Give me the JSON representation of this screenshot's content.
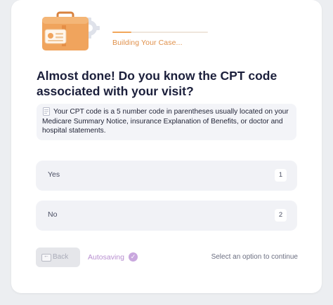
{
  "header": {
    "progress_fraction": 0.2,
    "status_text": "Building Your Case..."
  },
  "question": {
    "title": "Almost done! Do you know the CPT code associated with your visit?"
  },
  "hint": {
    "icon": "document-icon",
    "text": "Your CPT code is a 5 number code in parentheses usually located on your Medicare Summary Notice, insurance Explanation of Benefits, or doctor and hospital statements."
  },
  "options": [
    {
      "label": "Yes",
      "key": "1"
    },
    {
      "label": "No",
      "key": "2"
    }
  ],
  "footer": {
    "back_label": "Back",
    "autosave_label": "Autosaving",
    "select_hint": "Select an option to continue"
  },
  "colors": {
    "accent_orange": "#f2a65a",
    "question_text": "#1b1f3b",
    "autosave_purple": "#b88fd0",
    "option_bg": "#f1f2f6"
  }
}
